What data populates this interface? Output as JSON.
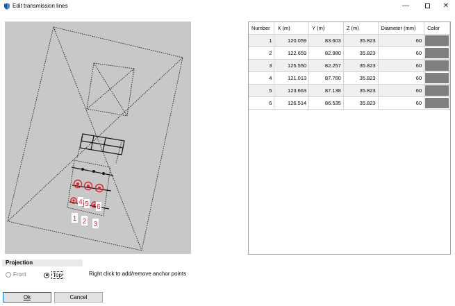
{
  "window": {
    "title": "Edit transmission lines",
    "minimize_glyph": "—",
    "close_glyph": "✕"
  },
  "table": {
    "headers": [
      "Number",
      "X (m)",
      "Y (m)",
      "Z (m)",
      "Diameter (mm)",
      "Color"
    ],
    "rows": [
      {
        "number": "1",
        "x": "120.059",
        "y": "83.603",
        "z": "35.823",
        "diameter": "60"
      },
      {
        "number": "2",
        "x": "122.659",
        "y": "82.980",
        "z": "35.823",
        "diameter": "60"
      },
      {
        "number": "3",
        "x": "125.550",
        "y": "82.257",
        "z": "35.823",
        "diameter": "60"
      },
      {
        "number": "4",
        "x": "121.013",
        "y": "87.760",
        "z": "35.823",
        "diameter": "60"
      },
      {
        "number": "5",
        "x": "123.663",
        "y": "87.138",
        "z": "35.823",
        "diameter": "60"
      },
      {
        "number": "6",
        "x": "126.514",
        "y": "86.535",
        "z": "35.823",
        "diameter": "60"
      }
    ],
    "row_color": "#808080"
  },
  "canvas": {
    "anchor_labels": [
      "1",
      "2",
      "3",
      "4",
      "5",
      "6"
    ],
    "background": "#c8c8c8",
    "anchor_color": "#e0202a"
  },
  "projection": {
    "title": "Projection",
    "options": [
      {
        "label": "Front",
        "selected": false
      },
      {
        "label": "Top",
        "selected": true
      }
    ]
  },
  "hint": "Right click to add/remove anchor points",
  "buttons": {
    "ok_label": "Ok",
    "cancel_label": "Cancel"
  }
}
